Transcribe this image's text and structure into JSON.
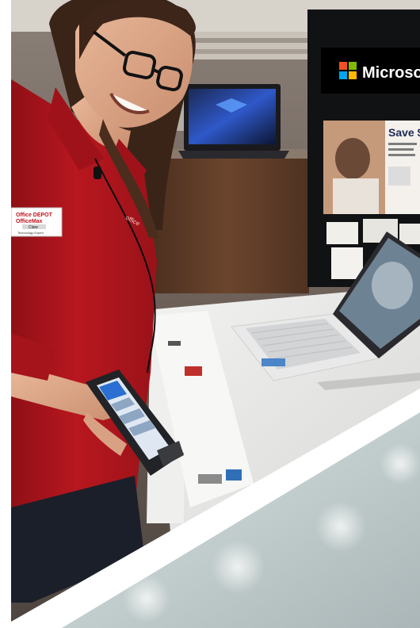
{
  "photo": {
    "sign": {
      "brand": "Microso"
    },
    "poster": {
      "headline": "Save $"
    },
    "name_badge": {
      "line1": "Office DEPOT",
      "line2": "OfficeMax",
      "name": "Clare",
      "role": "Technology Expert"
    },
    "shirt_logo": "office",
    "colors": {
      "shirt_red": "#b0141c",
      "store_bg": "#6f6259",
      "wood": "#5a3a26",
      "table": "#e6e6e4",
      "frosted_panel": "#c9d3d3",
      "microsoft_red": "#f25022",
      "microsoft_green": "#7fba00",
      "microsoft_blue": "#00a4ef",
      "microsoft_yellow": "#ffb900"
    }
  }
}
